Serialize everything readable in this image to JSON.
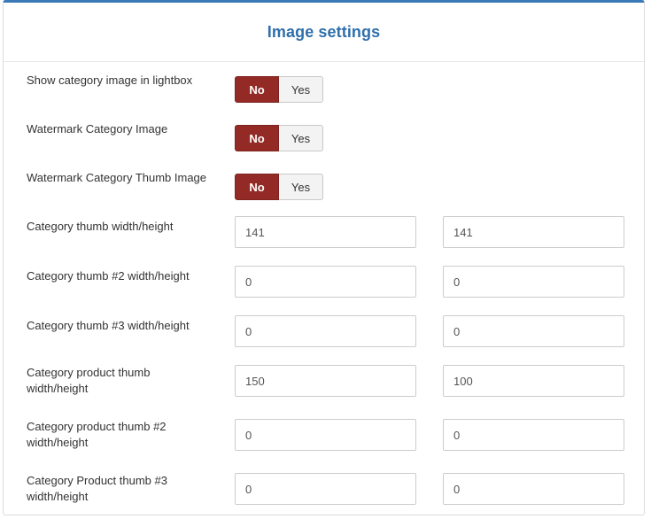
{
  "panel": {
    "title": "Image settings"
  },
  "toggles": [
    {
      "label": "Show category image in lightbox",
      "on_label": "No",
      "off_label": "Yes",
      "selected": "No"
    },
    {
      "label": "Watermark Category Image",
      "on_label": "No",
      "off_label": "Yes",
      "selected": "No"
    },
    {
      "label": "Watermark Category Thumb Image",
      "on_label": "No",
      "off_label": "Yes",
      "selected": "No"
    }
  ],
  "dimension_rows": [
    {
      "label": "Category thumb width/height",
      "width": "141",
      "height": "141"
    },
    {
      "label": "Category thumb #2 width/height",
      "width": "0",
      "height": "0"
    },
    {
      "label": "Category thumb #3 width/height",
      "width": "0",
      "height": "0"
    },
    {
      "label": "Category product thumb width/height",
      "width": "150",
      "height": "100"
    },
    {
      "label": "Category product thumb #2 width/height",
      "width": "0",
      "height": "0"
    },
    {
      "label": "Category Product thumb #3 width/height",
      "width": "0",
      "height": "0"
    }
  ],
  "colors": {
    "accent_blue": "#2f6fab",
    "active_toggle": "#942a25"
  }
}
